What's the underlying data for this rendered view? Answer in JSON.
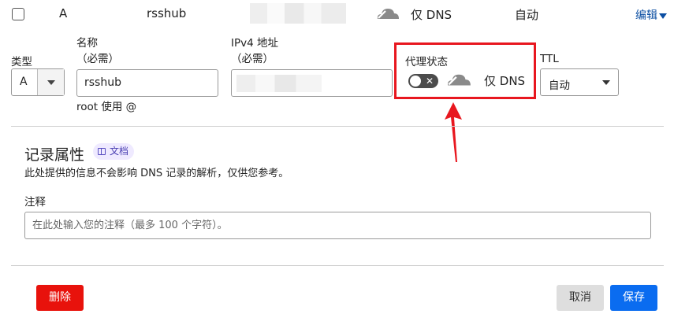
{
  "record_row": {
    "type": "A",
    "name": "rsshub",
    "proxy_status": "仅 DNS",
    "ttl": "自动",
    "edit_label": "编辑"
  },
  "form": {
    "type_label": "类型",
    "type_value": "A",
    "name_label": "名称",
    "name_required": "（必需）",
    "name_value": "rsshub",
    "name_help": "root 使用 @",
    "ipv4_label": "IPv4 地址",
    "ipv4_required": "（必需）",
    "proxy_label": "代理状态",
    "proxy_text": "仅 DNS",
    "ttl_label": "TTL",
    "ttl_value": "自动"
  },
  "record_attributes": {
    "title": "记录属性",
    "doc_badge": "文档",
    "description": "此处提供的信息不会影响 DNS 记录的解析，仅供您参考。",
    "note_label": "注释",
    "note_placeholder": "在此处输入您的注释（最多 100 个字符）。"
  },
  "actions": {
    "delete": "删除",
    "cancel": "取消",
    "save": "保存"
  },
  "colors": {
    "delete_bg": "#e8120c",
    "save_bg": "#0a6cf0",
    "highlight": "#e8171f",
    "link": "#0b4ea2",
    "cloud_gray": "#8a8a8a"
  },
  "icons": {
    "cloud": "dns-only-cloud-icon",
    "toggle": "proxy-toggle-off",
    "doc": "book-icon"
  }
}
